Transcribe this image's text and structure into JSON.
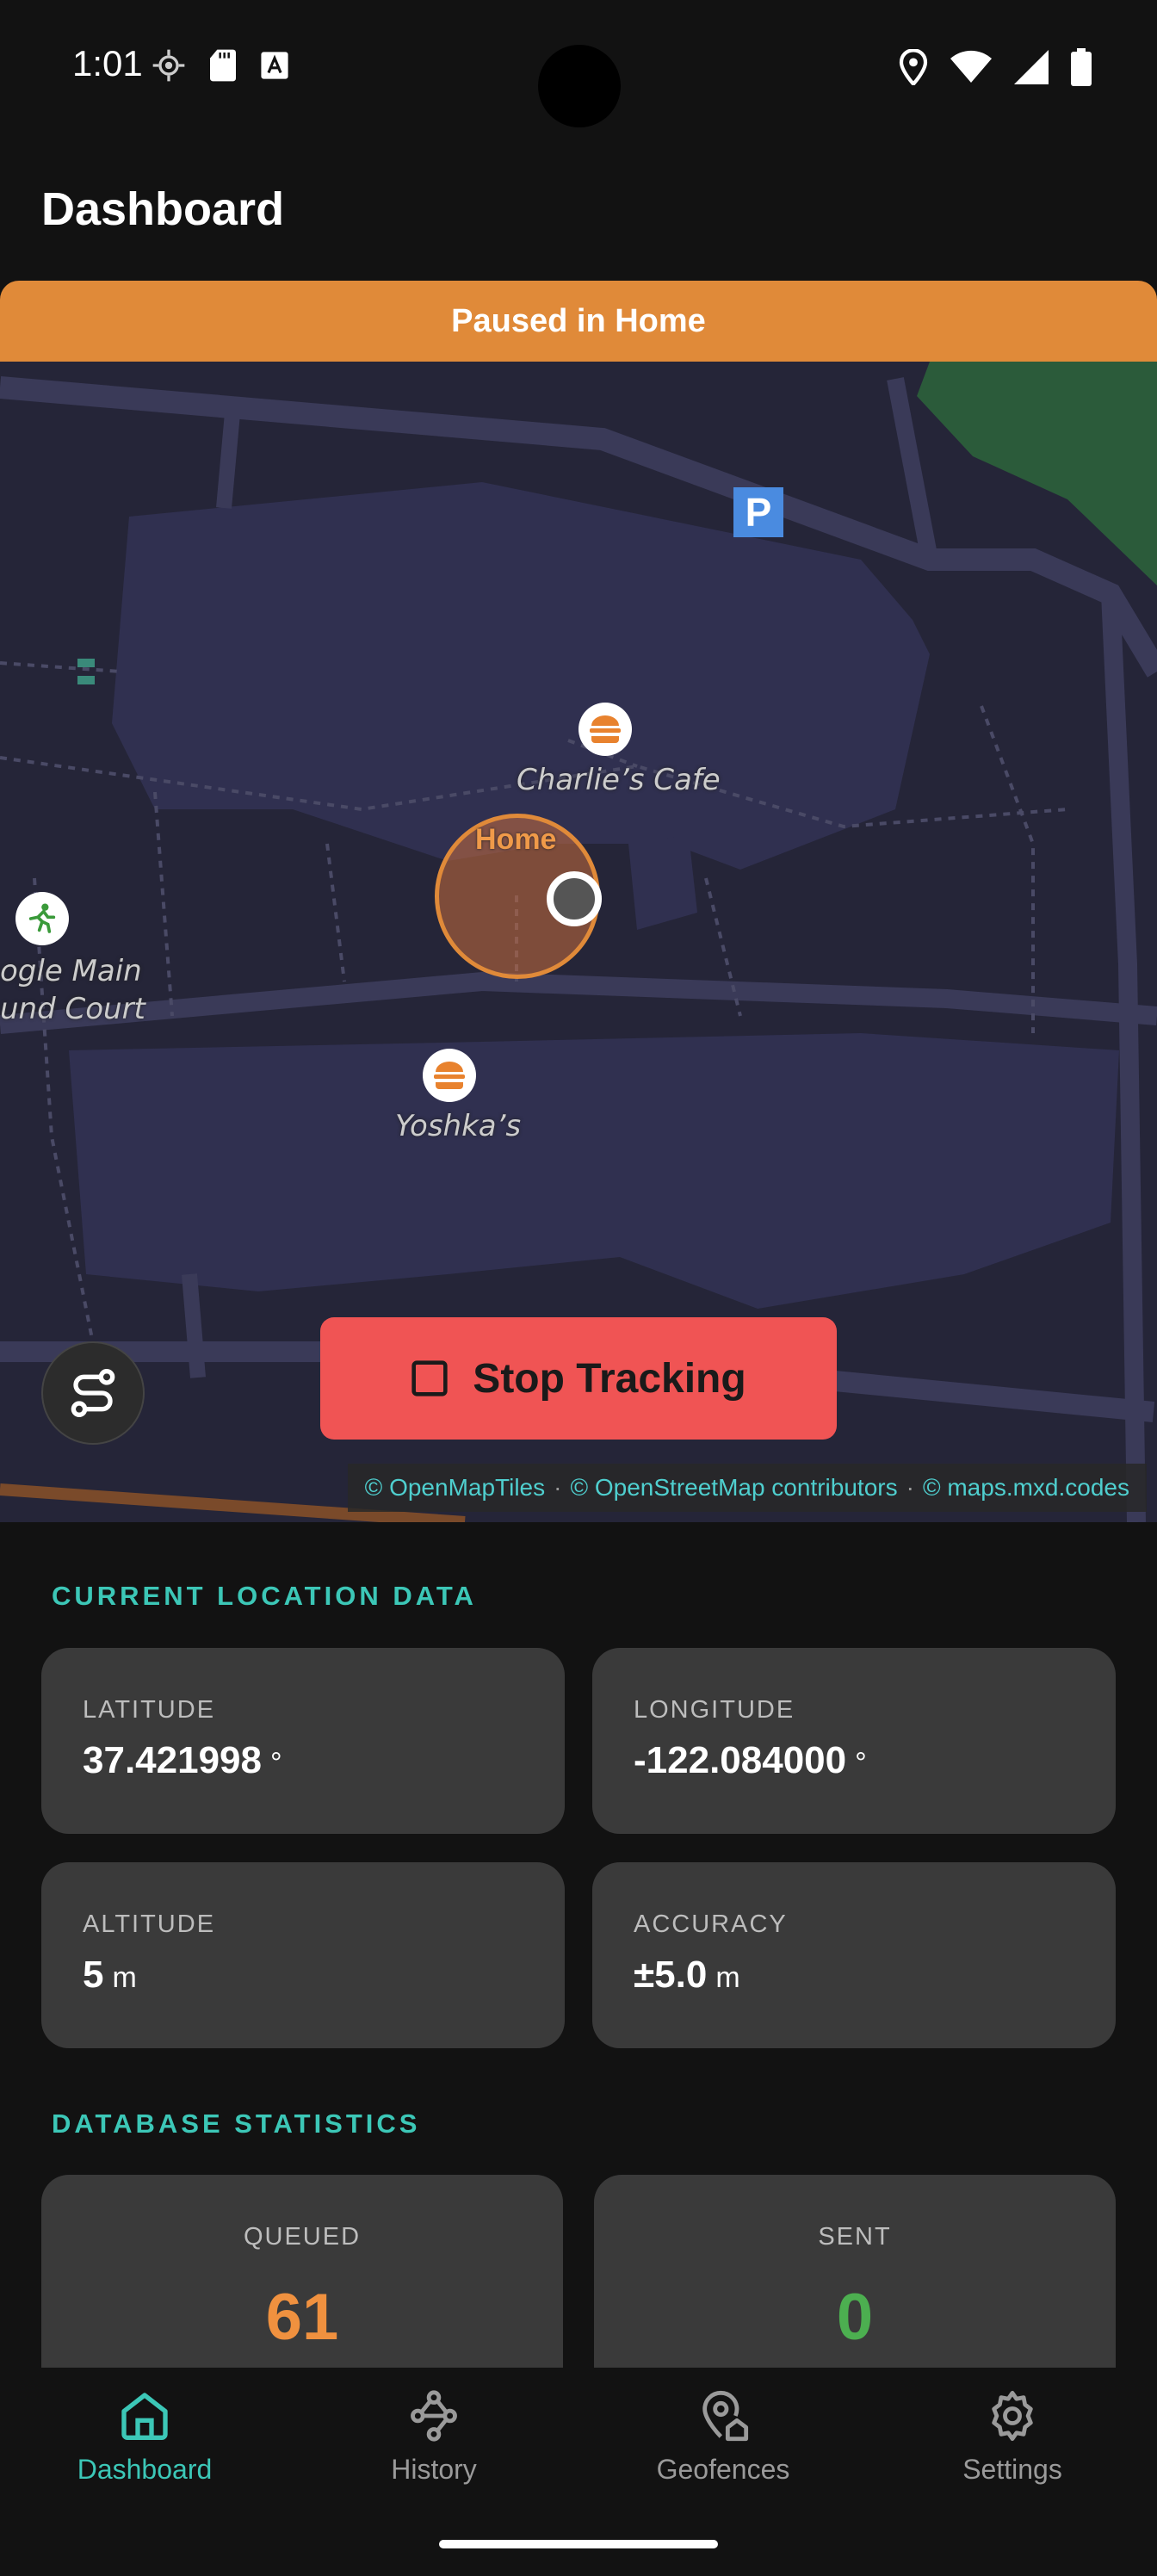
{
  "status_bar": {
    "time": "1:01"
  },
  "header": {
    "title": "Dashboard"
  },
  "banner": {
    "text": "Paused in Home",
    "color": "#E08A39"
  },
  "map": {
    "pois": [
      {
        "name": "Charlie’s Cafe",
        "icon": "burger-icon"
      },
      {
        "name": "Yoshka’s",
        "icon": "burger-icon"
      },
      {
        "name": "ogle Main\nund Court",
        "icon": "running-person-icon"
      }
    ],
    "parking_label": "P",
    "geofence_label": "Home",
    "stop_button_label": "Stop Tracking",
    "attribution": [
      "© OpenMapTiles",
      "© OpenStreetMap contributors",
      "© maps.mxd.codes"
    ]
  },
  "location": {
    "section_title": "CURRENT LOCATION DATA",
    "latitude": {
      "label": "LATITUDE",
      "value": "37.421998",
      "unit": "°"
    },
    "longitude": {
      "label": "LONGITUDE",
      "value": "-122.084000",
      "unit": "°"
    },
    "altitude": {
      "label": "ALTITUDE",
      "value": "5",
      "unit": "m"
    },
    "accuracy": {
      "label": "ACCURACY",
      "value": "±5.0",
      "unit": "m"
    }
  },
  "database": {
    "section_title": "DATABASE STATISTICS",
    "queued": {
      "label": "QUEUED",
      "value": "61",
      "color": "#F0913F"
    },
    "sent": {
      "label": "SENT",
      "value": "0",
      "color": "#4CAF50"
    }
  },
  "nav": {
    "active": "dashboard",
    "accent": "#3CC7B7",
    "items": [
      {
        "label": "Dashboard",
        "icon": "home-icon"
      },
      {
        "label": "History",
        "icon": "route-icon"
      },
      {
        "label": "Geofences",
        "icon": "geofence-pin-icon"
      },
      {
        "label": "Settings",
        "icon": "gear-icon"
      }
    ]
  }
}
